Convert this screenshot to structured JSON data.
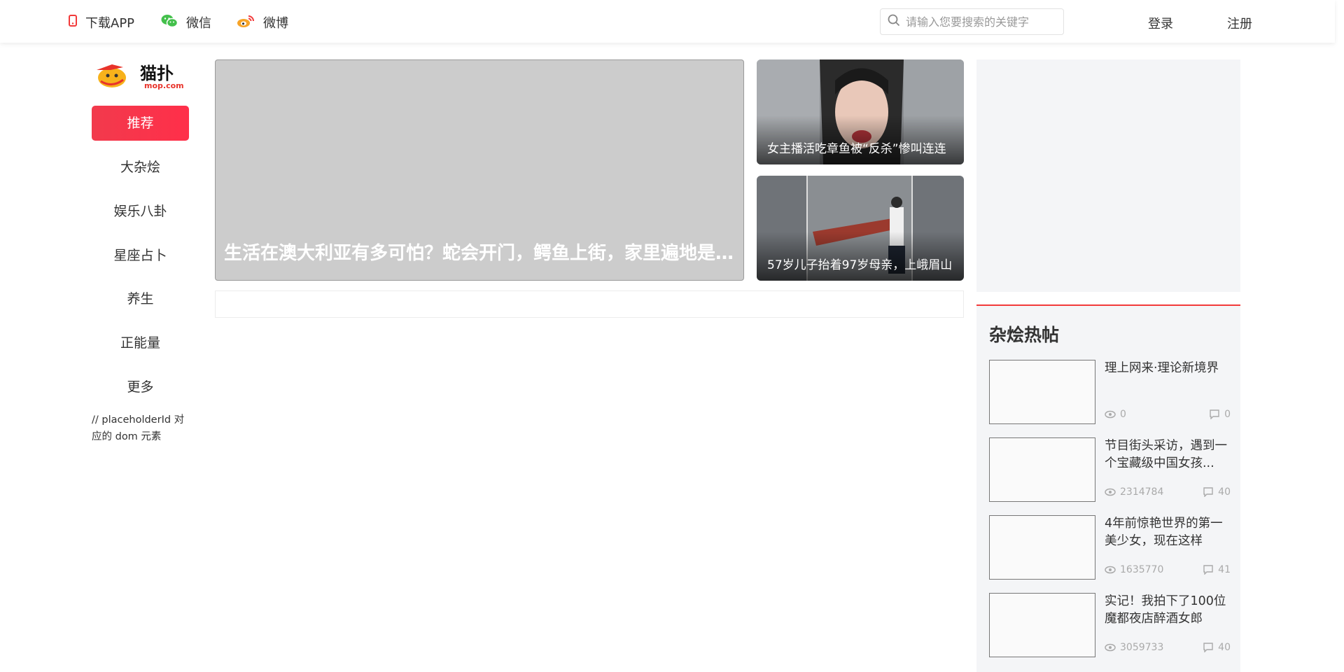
{
  "header": {
    "links": [
      {
        "label": "下载APP",
        "icon": "phone-icon",
        "color": "#f23a3a"
      },
      {
        "label": "微信",
        "icon": "wechat-icon",
        "color": "#43c04b"
      },
      {
        "label": "微博",
        "icon": "weibo-icon",
        "color": "#f7a428"
      }
    ],
    "search": {
      "placeholder": "请输入您要搜索的关键字",
      "value": ""
    },
    "login_label": "登录",
    "register_label": "注册"
  },
  "brand": {
    "logo_text": "猫扑",
    "logo_sub": "mop.com"
  },
  "sidebar_nav": {
    "items": [
      {
        "label": "推荐",
        "active": true
      },
      {
        "label": "大杂烩"
      },
      {
        "label": "娱乐八卦"
      },
      {
        "label": "星座占卜"
      },
      {
        "label": "养生"
      },
      {
        "label": "正能量"
      },
      {
        "label": "更多"
      }
    ],
    "note": "// placeholderId 对应的 dom 元素"
  },
  "featured": {
    "main": {
      "title": "生活在澳大利亚有多可怕？蛇会开门，鳄鱼上街，家里遍地是蜘蛛"
    },
    "side": [
      {
        "title": "女主播活吃章鱼被“反杀”惨叫连连"
      },
      {
        "title": "57岁儿子抬着97岁母亲，上峨眉山"
      }
    ]
  },
  "hot_posts": {
    "title": "杂烩热帖",
    "items": [
      {
        "title": "理上网来·理论新境界",
        "views": "0",
        "comments": "0"
      },
      {
        "title": "节目街头采访，遇到一个宝藏级中国女孩...",
        "views": "2314784",
        "comments": "40"
      },
      {
        "title": "4年前惊艳世界的第一美少女，现在这样",
        "views": "1635770",
        "comments": "41"
      },
      {
        "title": "实记！我拍下了100位魔都夜店醉酒女郎",
        "views": "3059733",
        "comments": "40"
      }
    ]
  },
  "colors": {
    "accent": "#f23a4c",
    "hot_border": "#f23a3a",
    "panel_bg": "#f4f5f7"
  }
}
